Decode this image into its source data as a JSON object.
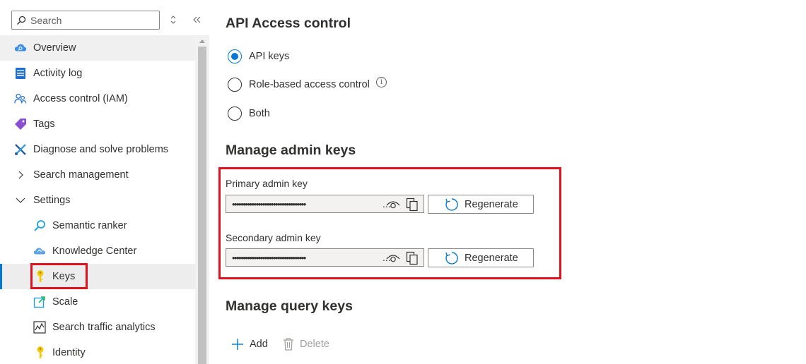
{
  "sidebar": {
    "search": {
      "placeholder": "Search"
    },
    "items": [
      {
        "label": "Overview",
        "icon": "overview-cloud-icon"
      },
      {
        "label": "Activity log",
        "icon": "activity-log-icon"
      },
      {
        "label": "Access control (IAM)",
        "icon": "people-icon"
      },
      {
        "label": "Tags",
        "icon": "tag-icon"
      },
      {
        "label": "Diagnose and solve problems",
        "icon": "wrench-icon"
      },
      {
        "label": "Search management",
        "icon": "chevron-right-icon"
      },
      {
        "label": "Settings",
        "icon": "chevron-down-icon"
      },
      {
        "label": "Semantic ranker",
        "icon": "search-icon"
      },
      {
        "label": "Knowledge Center",
        "icon": "cloud-icon"
      },
      {
        "label": "Keys",
        "icon": "key-icon"
      },
      {
        "label": "Scale",
        "icon": "scale-icon"
      },
      {
        "label": "Search traffic analytics",
        "icon": "chart-icon"
      },
      {
        "label": "Identity",
        "icon": "identity-key-icon"
      }
    ],
    "selected": "Keys"
  },
  "main": {
    "api_access_title": "API Access control",
    "radios": [
      {
        "label": "API keys",
        "checked": true
      },
      {
        "label": "Role-based access control",
        "checked": false
      },
      {
        "label": "Both",
        "checked": false
      }
    ],
    "info_glyph": "i",
    "admin_title": "Manage admin keys",
    "primary": {
      "label": "Primary admin key",
      "masked": "••••••••••••••••••••••••••••••••••",
      "ellipsis": "...",
      "regenerate": "Regenerate"
    },
    "secondary": {
      "label": "Secondary admin key",
      "masked": "••••••••••••••••••••••••••••••••••",
      "ellipsis": "...",
      "regenerate": "Regenerate"
    },
    "query_title": "Manage query keys",
    "add_label": "Add",
    "delete_label": "Delete"
  },
  "colors": {
    "accent": "#0078d4",
    "highlight": "#e3101e",
    "selected_bg": "#ededed"
  }
}
